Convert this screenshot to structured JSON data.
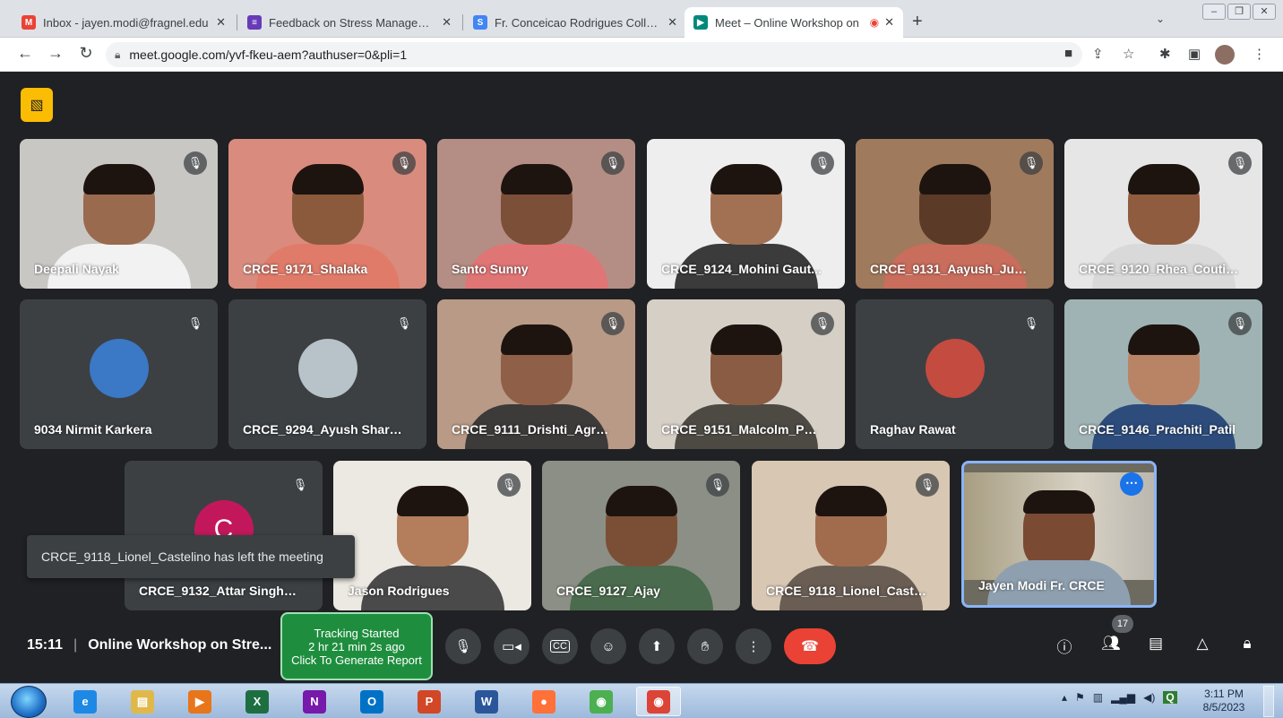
{
  "browser": {
    "tabs": [
      {
        "title": "Inbox - jayen.modi@fragnel.edu",
        "icon": "gmail-icon",
        "color": "#ea4335",
        "glyph": "M"
      },
      {
        "title": "Feedback on Stress Management",
        "icon": "forms-icon",
        "color": "#673ab7",
        "glyph": "≡"
      },
      {
        "title": "Fr. Conceicao Rodrigues College",
        "icon": "sites-icon",
        "color": "#4285f4",
        "glyph": "S"
      },
      {
        "title": "Meet – Online Workshop on",
        "icon": "meet-icon",
        "color": "#00897b",
        "glyph": "▶"
      }
    ],
    "url": "meet.google.com/yvf-fkeu-aem?authuser=0&pli=1"
  },
  "meeting": {
    "time": "15:11",
    "title": "Online Workshop on Stre...",
    "participant_count": "17",
    "toast": "CRCE_9118_Lionel_Castelino has left the meeting",
    "tracking": {
      "line1": "Tracking Started",
      "line2": "2 hr 21 min 2s ago",
      "line3": "Click To Generate Report"
    },
    "self_name": "Jayen Modi Fr. CRCE"
  },
  "participants": [
    {
      "name": "Deepali Nayak",
      "video": true,
      "bg": "#c9c7c4",
      "skin": "#9a6a4e",
      "shirt": "#f2f2f2"
    },
    {
      "name": "CRCE_9171_Shalaka",
      "video": true,
      "bg": "#d98b7e",
      "skin": "#8b5a3c",
      "shirt": "#e07b6a"
    },
    {
      "name": "Santo Sunny",
      "video": true,
      "bg": "#b48e84",
      "skin": "#7c4f38",
      "shirt": "#e07576"
    },
    {
      "name": "CRCE_9124_Mohini Gaut...",
      "video": true,
      "bg": "#eeeeee",
      "skin": "#a27153",
      "shirt": "#3b3b3b"
    },
    {
      "name": "CRCE_9131_Aayush_Juhu...",
      "video": true,
      "bg": "#a07a5c",
      "skin": "#5b3a27",
      "shirt": "#c96d5c"
    },
    {
      "name": "CRCE_9120_Rhea_Coutin...",
      "video": true,
      "bg": "#e6e6e6",
      "skin": "#8f5c40",
      "shirt": "#d9d9d9"
    },
    {
      "name": "9034 Nirmit Karkera",
      "video": false,
      "avatar": "#3b78c5"
    },
    {
      "name": "CRCE_9294_Ayush Sharma",
      "video": false,
      "avatar": "#b7c3c9"
    },
    {
      "name": "CRCE_9111_Drishti_Agra...",
      "video": true,
      "bg": "#b89a86",
      "skin": "#8f6047",
      "shirt": "#3d3a3a"
    },
    {
      "name": "CRCE_9151_Malcolm_Per...",
      "video": true,
      "bg": "#d6cfc6",
      "skin": "#8a5c43",
      "shirt": "#4d4a44"
    },
    {
      "name": "Raghav Rawat",
      "video": false,
      "avatar": "#c44b3f"
    },
    {
      "name": "CRCE_9146_Prachiti_Patil",
      "video": true,
      "bg": "#9fb3b4",
      "skin": "#b98466",
      "shirt": "#2d4c7c"
    },
    {
      "name": "CRCE_9132_Attar Singh_...",
      "video": false,
      "avatar": "#c2185b",
      "initial": "C"
    },
    {
      "name": "Jason Rodrigues",
      "video": true,
      "bg": "#ece8e2",
      "skin": "#b47d5c",
      "shirt": "#4a4a4a"
    },
    {
      "name": "CRCE_9127_Ajay",
      "video": true,
      "bg": "#8c8f86",
      "skin": "#7b4f36",
      "shirt": "#4a6b4d"
    },
    {
      "name": "CRCE_9118_Lionel_Castel...",
      "video": true,
      "bg": "#d8c7b3",
      "skin": "#a16c4d",
      "shirt": "#6a5d54"
    }
  ],
  "taskbar": {
    "apps": [
      {
        "name": "internet-explorer",
        "glyph": "e",
        "color": "#1e88e5"
      },
      {
        "name": "file-explorer",
        "glyph": "▤",
        "color": "#e0b84a"
      },
      {
        "name": "media-player",
        "glyph": "▶",
        "color": "#e8751a"
      },
      {
        "name": "excel",
        "glyph": "X",
        "color": "#1d6f42"
      },
      {
        "name": "onenote",
        "glyph": "N",
        "color": "#7719aa"
      },
      {
        "name": "outlook",
        "glyph": "O",
        "color": "#0072c6"
      },
      {
        "name": "powerpoint",
        "glyph": "P",
        "color": "#d24726"
      },
      {
        "name": "word",
        "glyph": "W",
        "color": "#2b579a"
      },
      {
        "name": "firefox",
        "glyph": "●",
        "color": "#ff7139"
      },
      {
        "name": "chrome",
        "glyph": "◉",
        "color": "#4caf50"
      },
      {
        "name": "chrome-meet",
        "glyph": "◉",
        "color": "#db4437"
      }
    ],
    "clock_time": "3:11 PM",
    "clock_date": "8/5/2023"
  }
}
